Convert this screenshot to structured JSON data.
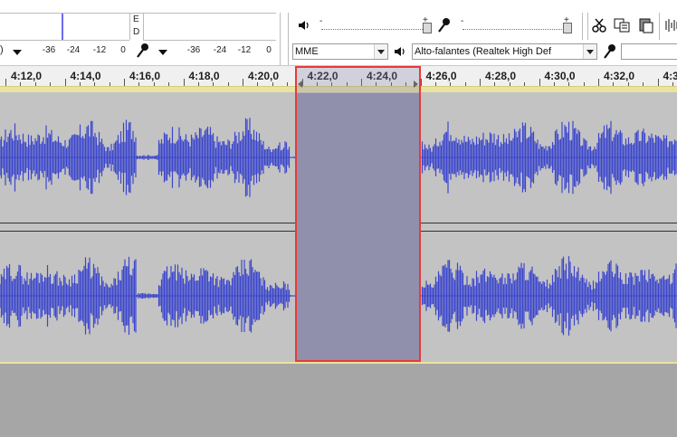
{
  "toolbar": {
    "meter_left": {
      "ticks": [
        "-36",
        "-24",
        "-12",
        "0"
      ],
      "record_ticks": [
        "-36",
        "-24",
        "-12",
        "0"
      ]
    },
    "channel_labels": {
      "left": "E",
      "right": "D"
    },
    "mixer": {
      "volume_icon": "speaker-icon",
      "mic_icon": "microphone-icon",
      "minus_a": "-",
      "plus_a": "+",
      "minus_b": "-",
      "plus_b": "+"
    },
    "host_combo": "MME",
    "output_combo": "Alto-falantes (Realtek High Def"
  },
  "ruler": {
    "labels": [
      "4:12,0",
      "4:14,0",
      "4:16,0",
      "4:18,0",
      "4:20,0",
      "4:22,0",
      "4:24,0",
      "4:26,0",
      "4:28,0",
      "4:30,0",
      "4:32,0",
      "4:3"
    ]
  },
  "track": {
    "wave_color": "#3c46cc",
    "bg_color": "#c3c3c3",
    "selection_color": "#9696ad",
    "selection_border": "#e83a3a"
  }
}
